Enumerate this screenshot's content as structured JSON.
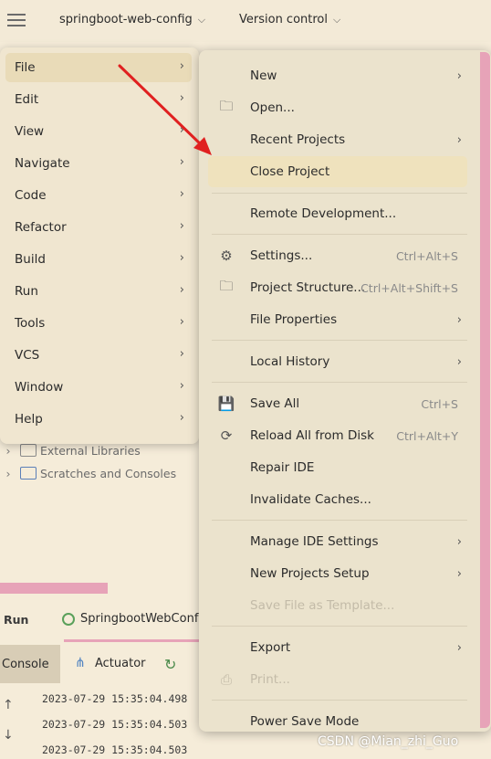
{
  "topbar": {
    "project_name": "springboot-web-config",
    "version_control": "Version control"
  },
  "tree": {
    "external_libraries": "External Libraries",
    "scratches": "Scratches and Consoles"
  },
  "bottom_panel": {
    "run_label": "Run",
    "run_config_tab": "SpringbootWebConf",
    "console_tab": "Console",
    "actuator_tab": "Actuator",
    "log_lines": [
      "2023-07-29 15:35:04.498",
      "2023-07-29 15:35:04.503",
      "2023-07-29 15:35:04.503"
    ]
  },
  "main_menu": {
    "items": [
      {
        "label": "File"
      },
      {
        "label": "Edit"
      },
      {
        "label": "View"
      },
      {
        "label": "Navigate"
      },
      {
        "label": "Code"
      },
      {
        "label": "Refactor"
      },
      {
        "label": "Build"
      },
      {
        "label": "Run"
      },
      {
        "label": "Tools"
      },
      {
        "label": "VCS"
      },
      {
        "label": "Window"
      },
      {
        "label": "Help"
      }
    ],
    "selected": "File"
  },
  "file_menu": {
    "items": [
      {
        "label": "New",
        "icon": "",
        "shortcut": "",
        "submenu": true
      },
      {
        "label": "Open...",
        "icon": "folder-icon",
        "shortcut": "",
        "submenu": false
      },
      {
        "label": "Recent Projects",
        "icon": "",
        "shortcut": "",
        "submenu": true
      },
      {
        "label": "Close Project",
        "icon": "",
        "shortcut": "",
        "submenu": false,
        "selected": true
      },
      {
        "label": "Remote Development...",
        "icon": "",
        "shortcut": "",
        "submenu": false
      },
      {
        "label": "Settings...",
        "icon": "gear-icon",
        "shortcut": "Ctrl+Alt+S",
        "submenu": false
      },
      {
        "label": "Project Structure...",
        "icon": "project-structure-icon",
        "shortcut": "Ctrl+Alt+Shift+S",
        "submenu": false
      },
      {
        "label": "File Properties",
        "icon": "",
        "shortcut": "",
        "submenu": true
      },
      {
        "label": "Local History",
        "icon": "",
        "shortcut": "",
        "submenu": true
      },
      {
        "label": "Save All",
        "icon": "save-icon",
        "shortcut": "Ctrl+S",
        "submenu": false
      },
      {
        "label": "Reload All from Disk",
        "icon": "reload-icon",
        "shortcut": "Ctrl+Alt+Y",
        "submenu": false
      },
      {
        "label": "Repair IDE",
        "icon": "",
        "shortcut": "",
        "submenu": false
      },
      {
        "label": "Invalidate Caches...",
        "icon": "",
        "shortcut": "",
        "submenu": false
      },
      {
        "label": "Manage IDE Settings",
        "icon": "",
        "shortcut": "",
        "submenu": true
      },
      {
        "label": "New Projects Setup",
        "icon": "",
        "shortcut": "",
        "submenu": true
      },
      {
        "label": "Save File as Template...",
        "icon": "",
        "shortcut": "",
        "submenu": false,
        "disabled": true
      },
      {
        "label": "Export",
        "icon": "",
        "shortcut": "",
        "submenu": true
      },
      {
        "label": "Print...",
        "icon": "print-icon",
        "shortcut": "",
        "submenu": false,
        "disabled": true
      },
      {
        "label": "Power Save Mode",
        "icon": "",
        "shortcut": "",
        "submenu": false
      }
    ]
  },
  "watermark": "CSDN @Mian_zhi_Guo",
  "colors": {
    "accent_pink": "#e7a3b8",
    "annotation_red": "#e02020",
    "selection": "#efe2bd"
  }
}
